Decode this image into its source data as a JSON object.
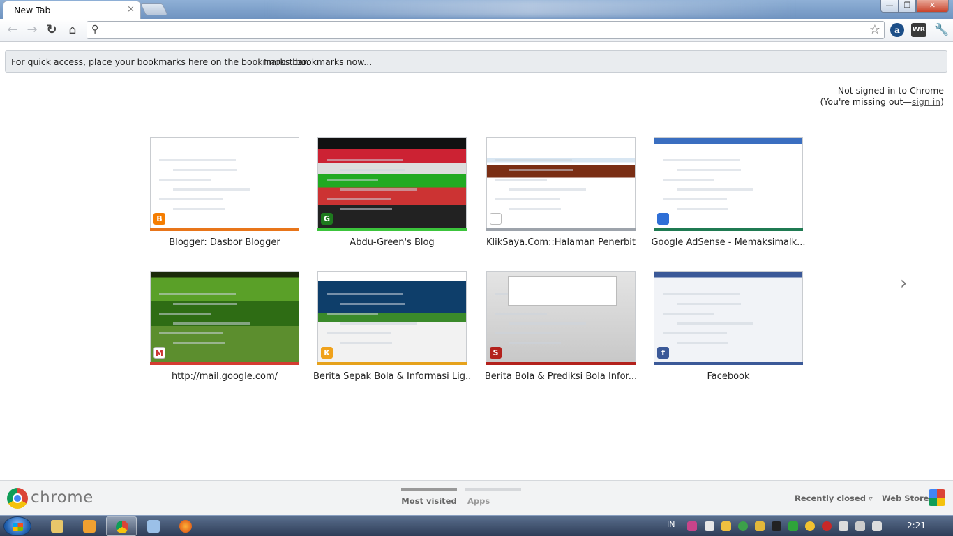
{
  "tab": {
    "title": "New Tab",
    "close": "×"
  },
  "window": {
    "minimize": "—",
    "maximize": "❐",
    "close": "✕"
  },
  "toolbar": {
    "back": "←",
    "forward": "→",
    "reload": "↻",
    "home": "⌂",
    "omnibox_value": "",
    "star": "☆",
    "ext_a": "a",
    "ext_wr": "WR",
    "wrench": "🔧"
  },
  "bookmarks_bar": {
    "message": "For quick access, place your bookmarks here on the bookmarks bar.",
    "import_link": "Import bookmarks now..."
  },
  "signin": {
    "line1": "Not signed in to Chrome",
    "line2_prefix": "(You're missing out—",
    "link": "sign in",
    "line2_suffix": ")"
  },
  "thumbnails": [
    {
      "label": "Blogger: Dasbor Blogger",
      "accent": "#e8751a",
      "fav_color": "#f57d00",
      "fav_glyph": "B"
    },
    {
      "label": "Abdu-Green's Blog",
      "accent": "#3cc43c",
      "fav_color": "#1e7a1e",
      "fav_glyph": "G"
    },
    {
      "label": "KlikSaya.Com::Halaman Penerbit",
      "accent": "#9da3ab",
      "fav_color": "#ffffff",
      "fav_glyph": ""
    },
    {
      "label": "Google AdSense - Memaksimalk...",
      "accent": "#1f7a52",
      "fav_color": "#2f6fd6",
      "fav_glyph": ""
    },
    {
      "label": "http://mail.google.com/",
      "accent": "#d43c32",
      "fav_color": "#ffffff",
      "fav_glyph": "M"
    },
    {
      "label": "Berita Sepak Bola & Informasi Lig...",
      "accent": "#e6a21c",
      "fav_color": "#f0a21c",
      "fav_glyph": "K"
    },
    {
      "label": "Berita Bola & Prediksi Bola Infor...",
      "accent": "#b3211c",
      "fav_color": "#b3211c",
      "fav_glyph": "S"
    },
    {
      "label": "Facebook",
      "accent": "#3b5998",
      "fav_color": "#3b5998",
      "fav_glyph": "f"
    }
  ],
  "next_arrow": "›",
  "footer": {
    "brand": "chrome",
    "most_visited": "Most visited",
    "apps": "Apps",
    "recently_closed": "Recently closed ▿",
    "web_store": "Web Store"
  },
  "taskbar": {
    "lang": "IN",
    "clock": "2:21"
  }
}
